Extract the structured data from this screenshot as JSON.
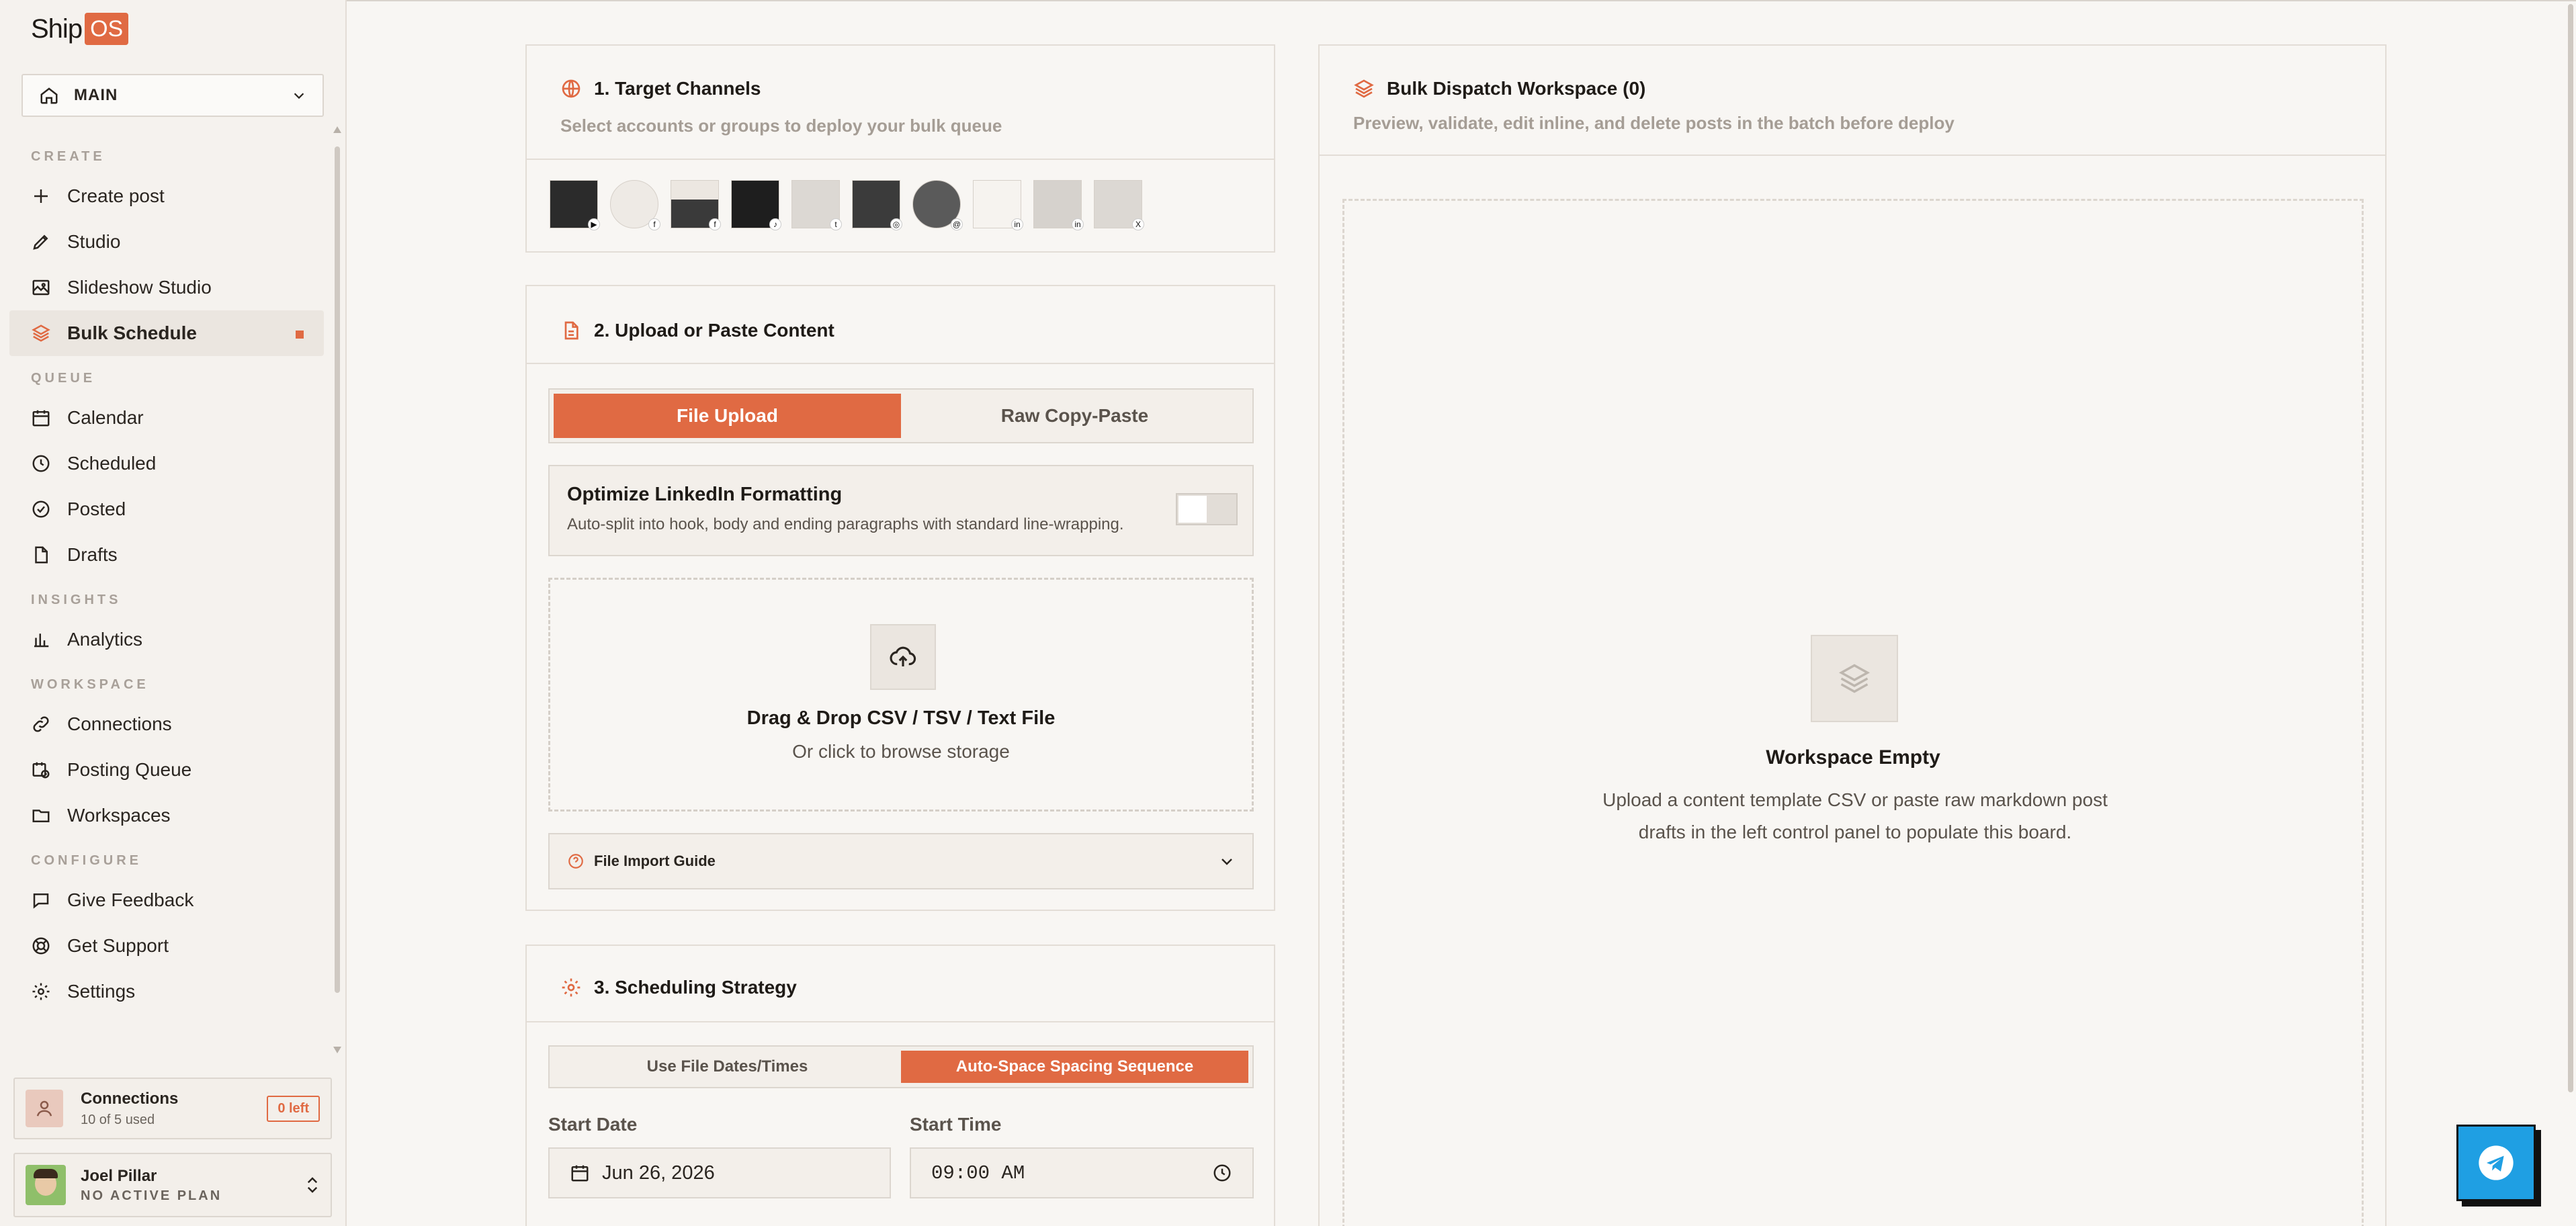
{
  "app": {
    "logo_text": "Ship",
    "logo_badge": "OS",
    "accent_color": "#e06a43"
  },
  "workspace": {
    "name": "MAIN"
  },
  "nav": {
    "sections": [
      {
        "title": "CREATE",
        "items": [
          "Create post",
          "Studio",
          "Slideshow Studio",
          "Bulk Schedule"
        ]
      },
      {
        "title": "QUEUE",
        "items": [
          "Calendar",
          "Scheduled",
          "Posted",
          "Drafts"
        ]
      },
      {
        "title": "INSIGHTS",
        "items": [
          "Analytics"
        ]
      },
      {
        "title": "WORKSPACE",
        "items": [
          "Connections",
          "Posting Queue",
          "Workspaces"
        ]
      },
      {
        "title": "CONFIGURE",
        "items": [
          "Give Feedback",
          "Get Support",
          "Settings"
        ]
      }
    ],
    "active": "Bulk Schedule"
  },
  "connections_card": {
    "title": "Connections",
    "subtitle": "10 of 5 used",
    "badge": "0 left"
  },
  "user": {
    "name": "Joel Pillar",
    "plan": "NO ACTIVE PLAN"
  },
  "target_channels": {
    "title": "1. Target Channels",
    "subtitle": "Select accounts or groups to deploy your bulk queue",
    "accounts": [
      {
        "platform_icon": "youtube-icon",
        "glyph": "▶"
      },
      {
        "platform_icon": "facebook-icon",
        "glyph": "f"
      },
      {
        "platform_icon": "facebook-icon",
        "glyph": "f"
      },
      {
        "platform_icon": "tiktok-icon",
        "glyph": "♪"
      },
      {
        "platform_icon": "twitter-icon",
        "glyph": "t"
      },
      {
        "platform_icon": "instagram-icon",
        "glyph": "◎"
      },
      {
        "platform_icon": "threads-icon",
        "glyph": "@"
      },
      {
        "platform_icon": "linkedin-icon",
        "glyph": "in"
      },
      {
        "platform_icon": "linkedin-icon",
        "glyph": "in"
      },
      {
        "platform_icon": "x-icon",
        "glyph": "X"
      }
    ]
  },
  "upload": {
    "title": "2. Upload or Paste Content",
    "tab_file": "File Upload",
    "tab_paste": "Raw Copy-Paste",
    "optimize_title": "Optimize LinkedIn Formatting",
    "optimize_desc": "Auto-split into hook, body and ending paragraphs with standard line-wrapping.",
    "optimize_enabled": false,
    "drop_title": "Drag & Drop CSV / TSV / Text File",
    "drop_sub": "Or click to browse storage",
    "guide_label": "File Import Guide"
  },
  "scheduling": {
    "title": "3. Scheduling Strategy",
    "mode_file": "Use File Dates/Times",
    "mode_auto": "Auto-Space Spacing Sequence",
    "start_date_label": "Start Date",
    "start_date": "Jun 26, 2026",
    "start_time_label": "Start Time",
    "start_time": "09:00 AM"
  },
  "workspace_panel": {
    "title": "Bulk Dispatch Workspace (0)",
    "subtitle": "Preview, validate, edit inline, and delete posts in the batch before deploy",
    "empty_title": "Workspace Empty",
    "empty_desc": "Upload a content template CSV or paste raw markdown post drafts in the left control panel to populate this board."
  }
}
